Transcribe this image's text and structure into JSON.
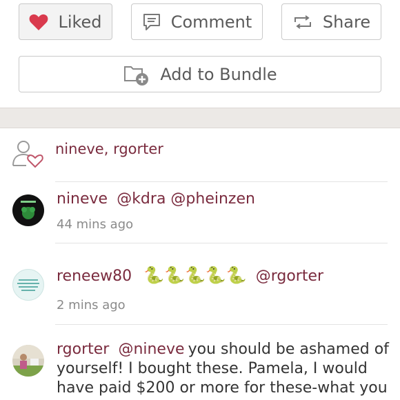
{
  "actions": {
    "liked_label": "Liked",
    "comment_label": "Comment",
    "share_label": "Share",
    "bundle_label": "Add to Bundle",
    "accent_color": "#d93a4d"
  },
  "likes": {
    "names": "nineve, rgorter"
  },
  "comments": [
    {
      "user": "nineve",
      "mentions": "@kdra @pheinzen",
      "time": "44 mins ago"
    },
    {
      "user": "reneew80",
      "emoji": "🐍🐍🐍🐍🐍",
      "mention": "@rgorter",
      "time": "2 mins ago"
    },
    {
      "user": "rgorter",
      "mention": "@nineve",
      "text_1": "you should be ashamed of",
      "text_2": "yourself! I bought these. Pamela, I would",
      "text_3": "have paid $200 or more for these-what you"
    }
  ]
}
